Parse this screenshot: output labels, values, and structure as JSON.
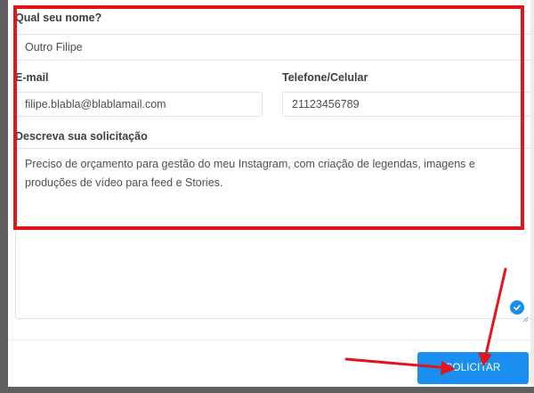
{
  "form": {
    "name": {
      "label": "Qual seu nome?",
      "value": "Outro Filipe"
    },
    "email": {
      "label": "E-mail",
      "value": "filipe.blabla@blablamail.com"
    },
    "phone": {
      "label": "Telefone/Celular",
      "value": "21123456789"
    },
    "request": {
      "label": "Descreva sua solicitação",
      "value": "Preciso de orçamento para gestão do meu Instagram, com criação de legendas, imagens e produções de vídeo para feed e Stories."
    },
    "submit_label": "SOLICITAR"
  },
  "annotation": {
    "highlight_color": "#e2151c",
    "arrow_color": "#e2151c"
  },
  "colors": {
    "accent": "#1a8ff0"
  },
  "icons": {
    "textarea_status": "check-circle-icon",
    "resize": "resize-grip-icon"
  }
}
